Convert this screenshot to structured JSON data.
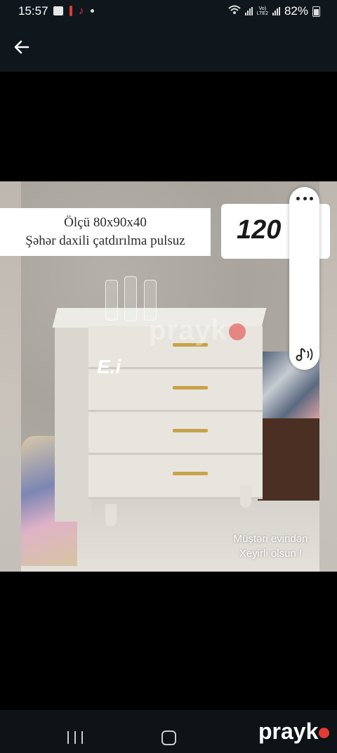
{
  "status_bar": {
    "time": "15:57",
    "battery": "82%",
    "network": "LTE2"
  },
  "app_bar": {
    "back_icon": "arrow-left-icon"
  },
  "photo": {
    "size_label": "Ölçü 80x90x40",
    "delivery_label": "Şəhər daxili çatdırılma pulsuz",
    "price": "120",
    "brand_mark": "E.i",
    "watermark": "prayk",
    "caption_line1": "Müştəri evindən",
    "caption_line2": "Xeyirli olsun !"
  },
  "floating_controls": {
    "more_icon": "more-horizontal-icon",
    "audio_icon": "audio-note-icon"
  },
  "nav_bar": {
    "brand": "prayk",
    "brand_color": "#e53935"
  }
}
